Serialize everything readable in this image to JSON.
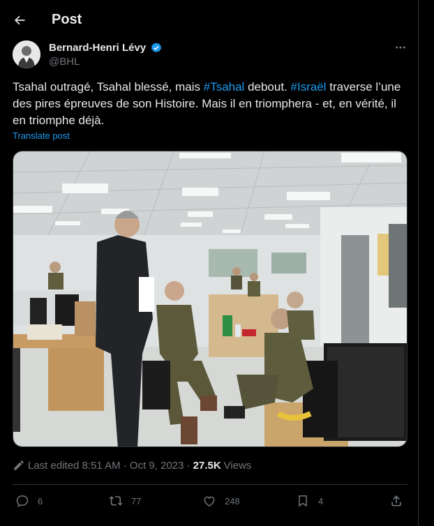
{
  "header": {
    "title": "Post"
  },
  "author": {
    "name": "Bernard-Henri Lévy",
    "handle": "@BHL"
  },
  "tweet": {
    "part1": "Tsahal outragé, Tsahal blessé, mais ",
    "hashtag1": "#Tsahal",
    "part2": " debout. ",
    "hashtag2": "#Israël",
    "part3": " traverse l’une des pires épreuves de son Histoire. Mais il en triomphera - et, en vérité, il en triomphe déjà."
  },
  "translate_label": "Translate post",
  "meta": {
    "edited": "Last edited 8:51 AM · Oct 9, 2023 · ",
    "views_count": "27.5K",
    "views_label": "Views"
  },
  "actions": {
    "replies": "6",
    "reposts": "77",
    "likes": "248",
    "bookmarks": "4"
  },
  "colors": {
    "accent": "#1d9bf0",
    "muted": "#71767b",
    "text": "#e7e9ea",
    "background": "#000000"
  },
  "icons": [
    "back-arrow-icon",
    "verified-badge-icon",
    "more-icon",
    "edit-pencil-icon",
    "reply-icon",
    "repost-icon",
    "like-icon",
    "bookmark-icon",
    "share-icon"
  ]
}
